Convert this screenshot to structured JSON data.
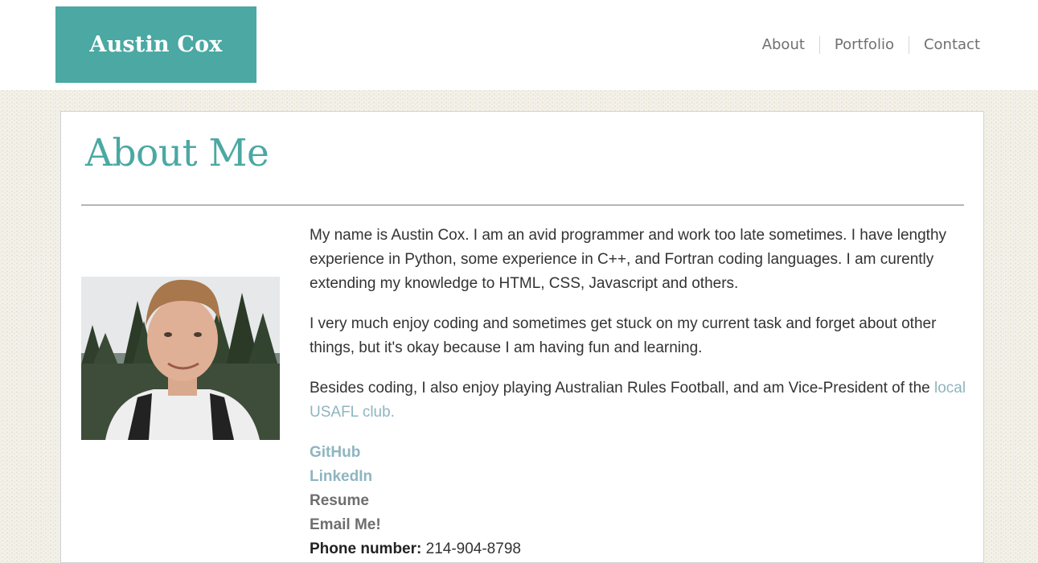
{
  "header": {
    "logo_text": "Austin Cox",
    "nav": [
      {
        "label": "About"
      },
      {
        "label": "Portfolio"
      },
      {
        "label": "Contact"
      }
    ]
  },
  "main": {
    "title": "About Me",
    "photo_alt": "Austin Cox",
    "paragraphs": {
      "p1": "My name is Austin Cox. I am an avid programmer and work too late sometimes. I have lengthy experience in Python, some experience in C++, and Fortran coding languages. I am curently extending my knowledge to HTML, CSS, Javascript and others.",
      "p2": "I very much enjoy coding and sometimes get stuck on my current task and forget about other things, but it's okay because I am having fun and learning.",
      "p3_text": "Besides coding, I also enjoy playing Australian Rules Football, and am Vice-President of the ",
      "p3_link": "local USAFL club."
    },
    "links": {
      "github": "GitHub",
      "linkedin": "LinkedIn",
      "resume": "Resume",
      "email": "Email Me!",
      "phone_label": "Phone number:",
      "phone_value": "214-904-8798"
    }
  },
  "colors": {
    "brand": "#4ba8a3",
    "link": "#8fb5c0",
    "nav_text": "#707070"
  },
  "icons": {
    "profile_photo": "person-portrait"
  }
}
